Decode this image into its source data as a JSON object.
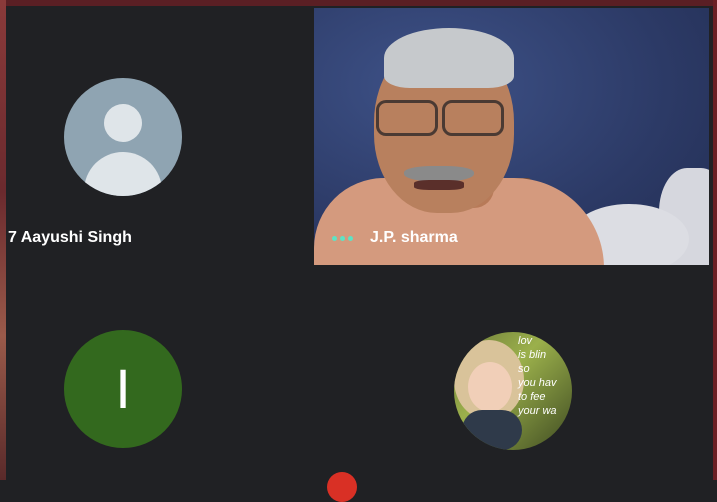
{
  "participants": [
    {
      "id": "aayushi",
      "name": "7 Aayushi Singh",
      "avatar": "person-icon"
    },
    {
      "id": "jp",
      "name": "J.P. sharma",
      "speaking": true
    },
    {
      "id": "i",
      "initial": "I",
      "avatar_color": "#33691e"
    },
    {
      "id": "girl",
      "avatar_text": [
        "lov",
        "is blin",
        "so",
        "you hav",
        "to fee",
        "your wa"
      ]
    }
  ],
  "colors": {
    "background": "#202124",
    "speaking_indicator": "#5ee3c4"
  }
}
